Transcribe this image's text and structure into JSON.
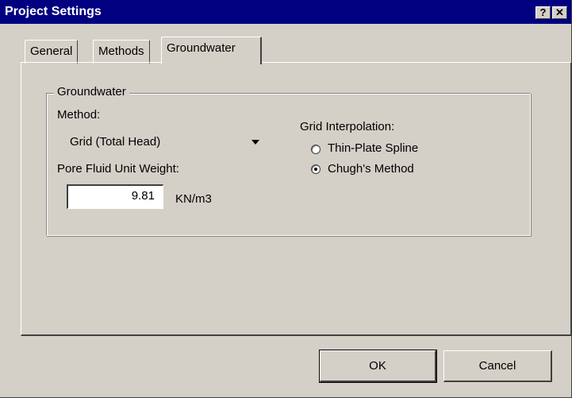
{
  "window": {
    "title": "Project Settings",
    "help_button": "?",
    "close_button": "✕"
  },
  "tabs": [
    {
      "label": "General",
      "active": false
    },
    {
      "label": "Methods",
      "active": false
    },
    {
      "label": "Groundwater",
      "active": true
    }
  ],
  "groundwater": {
    "group_title": "Groundwater",
    "method_label": "Method:",
    "method_value": "Grid (Total Head)",
    "pore_fluid_label": "Pore Fluid Unit Weight:",
    "pore_fluid_value": "9.81",
    "pore_fluid_unit": "KN/m3",
    "interpolation_label": "Grid Interpolation:",
    "interpolation_options": [
      {
        "label": "Thin-Plate Spline",
        "selected": false
      },
      {
        "label": "Chugh's Method",
        "selected": true
      }
    ]
  },
  "buttons": {
    "ok": "OK",
    "cancel": "Cancel"
  },
  "colors": {
    "face": "#d4d0c8",
    "titlebar": "#000080",
    "title_text": "#ffffff"
  }
}
